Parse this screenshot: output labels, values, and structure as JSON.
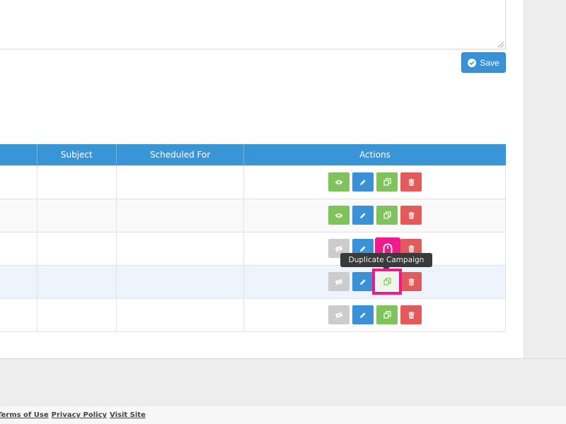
{
  "form": {
    "save_label": "Save"
  },
  "table": {
    "columns": [
      "",
      "Subject",
      "Scheduled For",
      "Actions"
    ],
    "rows": [
      {
        "col0": "",
        "subject": "",
        "scheduled_for": "",
        "view_enabled": true
      },
      {
        "col0": "",
        "subject": "",
        "scheduled_for": "",
        "view_enabled": true
      },
      {
        "col0": "",
        "subject": "",
        "scheduled_for": "",
        "view_enabled": false
      },
      {
        "col0": "",
        "subject": "",
        "scheduled_for": "",
        "view_enabled": false
      },
      {
        "col0": "",
        "subject": "",
        "scheduled_for": "",
        "view_enabled": false
      }
    ]
  },
  "tooltip": {
    "text": "Duplicate Campaign"
  },
  "icons": {
    "view": "eye-icon",
    "edit": "pencil-icon",
    "duplicate": "copy-icon",
    "delete": "trash-icon",
    "save": "check-circle-icon",
    "cursor": "mouse-icon"
  },
  "footer": {
    "terms": "Terms of Use",
    "privacy": "Privacy Policy",
    "visit": "Visit Site"
  },
  "colors": {
    "primary": "#3a91d6",
    "success": "#80c25b",
    "danger": "#e25a5a",
    "disabled": "#cccccc",
    "highlight": "#ef1b8d"
  }
}
